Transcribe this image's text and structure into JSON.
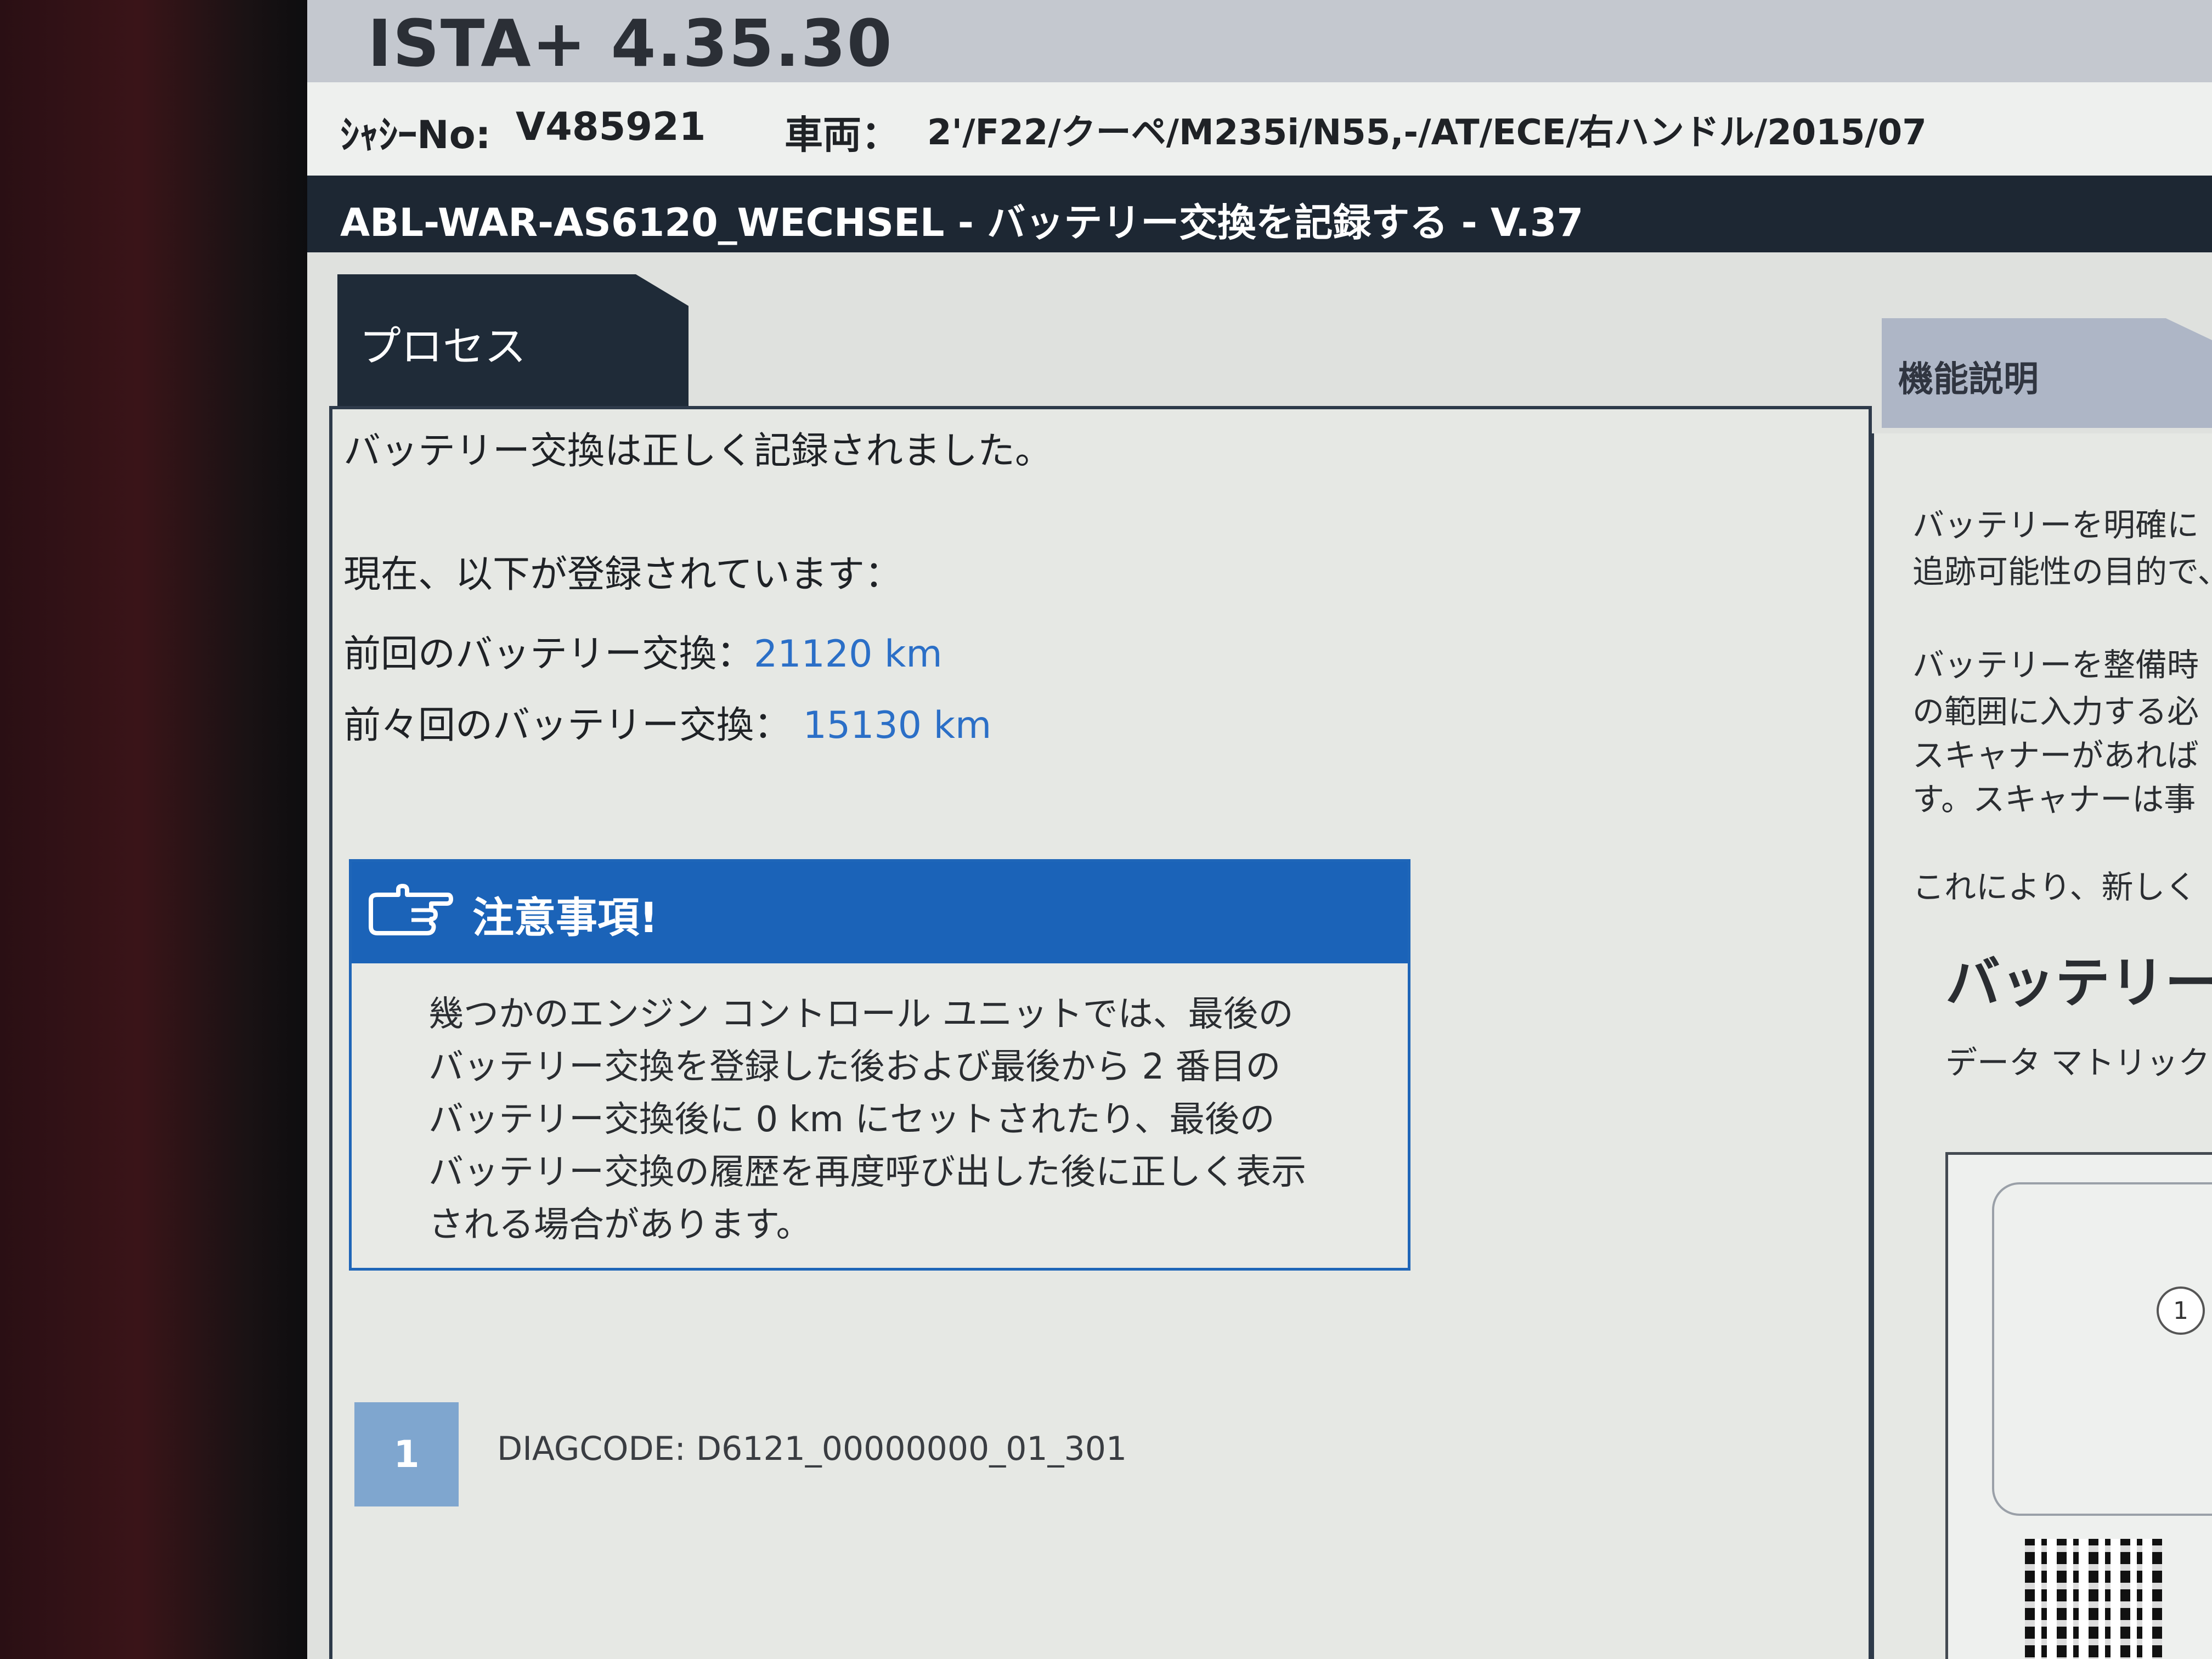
{
  "app": {
    "title": "ISTA+ 4.35.30"
  },
  "vehicle": {
    "chassis_label": "ｼｬｼｰNo:",
    "chassis_value": "V485921",
    "vehicle_label": "車両：",
    "vehicle_value": "2'/F22/クーペ/M235i/N55,-/AT/ECE/右ハンドル/2015/07"
  },
  "header": {
    "process_title": "ABL-WAR-AS6120_WECHSEL - バッテリー交換を記録する - V.37"
  },
  "tabs": {
    "process": "プロセス",
    "function_desc": "機能説明"
  },
  "main": {
    "success_message": "バッテリー交換は正しく記録されました。",
    "registered_intro": "現在、以下が登録されています：",
    "last_change_label": "前回のバッテリー交換：",
    "last_change_value": "21120 km",
    "prev_change_label": "前々回のバッテリー交換：",
    "prev_change_value": "15130 km",
    "notice": {
      "title": "注意事項!",
      "lines": [
        "幾つかのエンジン コントロール ユニットでは、最後の",
        "バッテリー交換を登録した後および最後から 2 番目の",
        "バッテリー交換後に 0 km にセットされたり、最後の",
        "バッテリー交換の履歴を再度呼び出した後に正しく表示",
        "される場合があります。"
      ]
    },
    "step_number": "1",
    "diagcode": "DIAGCODE: D6121_00000000_01_301"
  },
  "side": {
    "lines": [
      "バッテリーを明確に",
      "追跡可能性の目的で、",
      "バッテリーを整備時",
      "の範囲に入力する必",
      "スキャナーがあれば",
      "す。スキャナーは事",
      "これにより、新しく"
    ],
    "heading": "バッテリー",
    "subline": "データ マトリック",
    "callout": "1"
  },
  "colors": {
    "accent_blue": "#1b63b8",
    "value_blue": "#2b6fc7",
    "dark_bar": "#1d2733"
  }
}
